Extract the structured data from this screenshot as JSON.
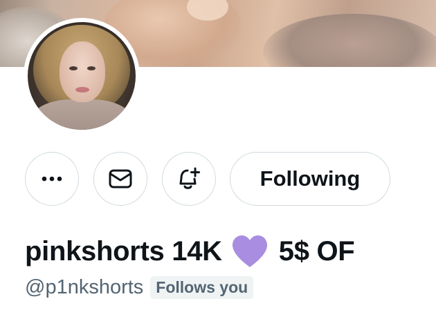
{
  "profile": {
    "display_name_before": "pinkshorts 14K",
    "display_name_emoji": "purple-heart",
    "display_name_after": "5$ OF",
    "handle": "@p1nkshorts",
    "follows_you_badge": "Follows you"
  },
  "actions": {
    "more_icon": "ellipsis-icon",
    "message_icon": "mail-icon",
    "notifications_icon": "bell-plus-icon",
    "follow_state_label": "Following"
  },
  "colors": {
    "text_primary": "#0f1419",
    "text_secondary": "#536471",
    "button_border": "#cfd9de",
    "badge_bg": "#eff3f4",
    "heart": "#a98de0"
  }
}
